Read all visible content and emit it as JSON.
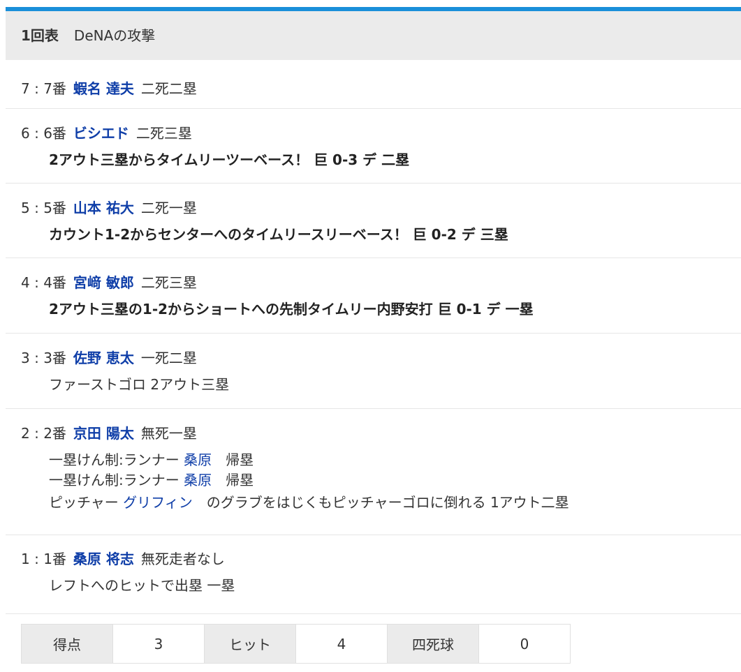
{
  "header": {
    "inning": "1回表",
    "team": "DeNAの攻撃"
  },
  "events": [
    {
      "num": "7",
      "order": "7番",
      "player": "蝦名 達夫",
      "runners": "二死二塁"
    },
    {
      "num": "6",
      "order": "6番",
      "player": "ビシエド",
      "runners": "二死三塁",
      "detail": "2アウト三塁からタイムリーツーベース！ 巨 0-3 デ 二塁"
    },
    {
      "num": "5",
      "order": "5番",
      "player": "山本 祐大",
      "runners": "二死一塁",
      "detail": "カウント1-2からセンターへのタイムリースリーベース！ 巨 0-2 デ 三塁"
    },
    {
      "num": "4",
      "order": "4番",
      "player": "宮﨑 敏郎",
      "runners": "二死三塁",
      "detail": "2アウト三塁の1-2からショートへの先制タイムリー内野安打 巨 0-1 デ 一塁"
    },
    {
      "num": "3",
      "order": "3番",
      "player": "佐野 恵太",
      "runners": "一死二塁",
      "detail": "ファーストゴロ 2アウト三塁"
    },
    {
      "num": "2",
      "order": "2番",
      "player": "京田 陽太",
      "runners": "無死一塁",
      "lines": [
        {
          "pre": "一塁けん制:ランナー ",
          "link": "桑原",
          "post": "　帰塁"
        },
        {
          "pre": "一塁けん制:ランナー ",
          "link": "桑原",
          "post": "　帰塁"
        },
        {
          "pre": "ピッチャー ",
          "link": "グリフィン",
          "post": "　のグラブをはじくもピッチャーゴロに倒れる 1アウト二塁"
        }
      ]
    },
    {
      "num": "1",
      "order": "1番",
      "player": "桑原 将志",
      "runners": "無死走者なし",
      "detail": "レフトへのヒットで出塁 一塁"
    }
  ],
  "stats": {
    "runs_label": "得点",
    "runs": "3",
    "hits_label": "ヒット",
    "hits": "4",
    "walks_label": "四死球",
    "walks": "0"
  }
}
